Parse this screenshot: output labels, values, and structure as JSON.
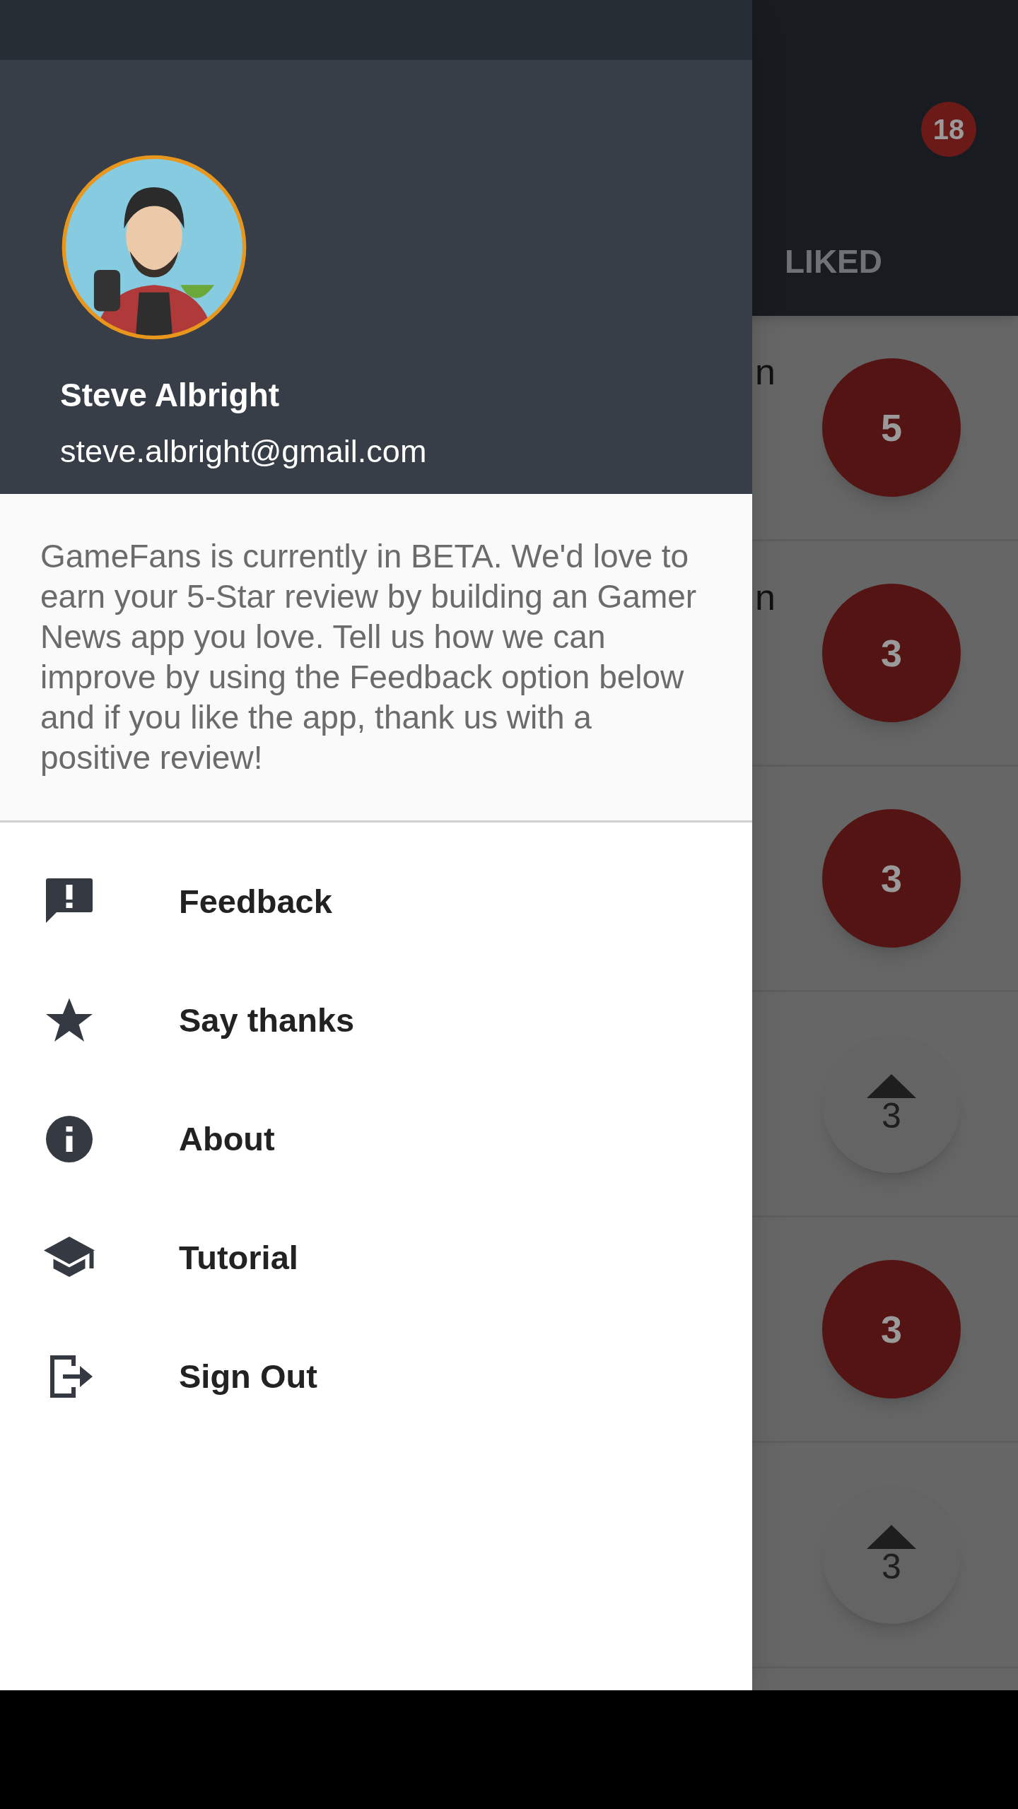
{
  "behind_drawer": {
    "notification_count": "18",
    "tab": "LIKED",
    "rows": [
      {
        "title": "n",
        "votes": "5",
        "voted": true
      },
      {
        "title": "n",
        "votes": "3",
        "voted": true
      },
      {
        "votes": "3",
        "voted": true
      },
      {
        "votes": "3",
        "voted": false
      },
      {
        "votes": "3",
        "voted": true
      },
      {
        "votes": "3",
        "voted": false
      }
    ]
  },
  "drawer": {
    "user": {
      "name": "Steve Albright",
      "email": "steve.albright@gmail.com"
    },
    "notice": "GameFans is currently in BETA. We'd love to earn your 5-Star review by building an Gamer News app you love. Tell us how we can improve by using the Feedback option below and if you like the app, thank us with a positive review!",
    "menu": [
      {
        "label": "Feedback",
        "kind": "feedback"
      },
      {
        "label": "Say thanks",
        "kind": "star"
      },
      {
        "label": "About",
        "kind": "info"
      },
      {
        "label": "Tutorial",
        "kind": "school"
      },
      {
        "label": "Sign Out",
        "kind": "exit"
      }
    ]
  }
}
